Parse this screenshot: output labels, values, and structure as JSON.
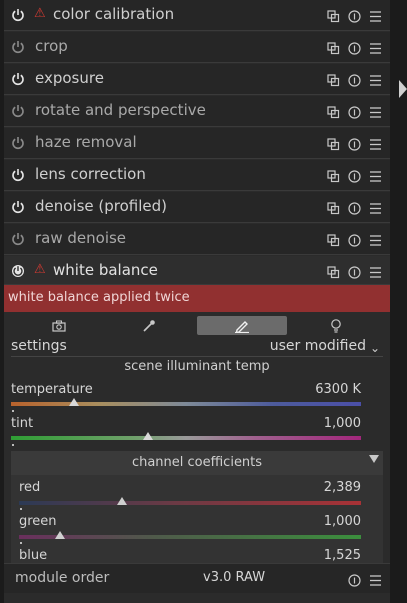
{
  "modules": [
    {
      "name": "color calibration",
      "power_on": true,
      "warning": true
    },
    {
      "name": "crop",
      "power_on": false,
      "warning": false
    },
    {
      "name": "exposure",
      "power_on": true,
      "warning": false
    },
    {
      "name": "rotate and perspective",
      "power_on": false,
      "warning": false
    },
    {
      "name": "haze removal",
      "power_on": false,
      "warning": false
    },
    {
      "name": "lens correction",
      "power_on": true,
      "warning": false
    },
    {
      "name": "denoise (profiled)",
      "power_on": true,
      "warning": false
    },
    {
      "name": "raw denoise",
      "power_on": false,
      "warning": false
    },
    {
      "name": "white balance",
      "power_on": true,
      "warning": true,
      "expanded": true
    }
  ],
  "white_balance": {
    "alert": "white balance applied twice",
    "tabs": [
      {
        "icon": "camera-icon",
        "active": false
      },
      {
        "icon": "picker-icon",
        "active": false
      },
      {
        "icon": "pencil-icon",
        "active": true
      },
      {
        "icon": "bulb-icon",
        "active": false
      }
    ],
    "settings_label": "settings",
    "settings_value": "user modified",
    "illuminant_title": "scene illuminant temp",
    "temperature": {
      "label": "temperature",
      "value": "6300 K",
      "level": 0.18
    },
    "tint": {
      "label": "tint",
      "value": "1,000",
      "level": 0.39
    },
    "coefficients_title": "channel coefficients",
    "red": {
      "label": "red",
      "value": "2,389",
      "level": 0.3
    },
    "green": {
      "label": "green",
      "value": "1,000",
      "level": 0.12
    },
    "blue": {
      "label": "blue",
      "value": "1,525"
    }
  },
  "footer": {
    "label": "module order",
    "version": "v3.0 RAW"
  },
  "colors": {
    "panel": "#2b2b2b",
    "alert": "#913030",
    "warning": "#d23a32"
  }
}
